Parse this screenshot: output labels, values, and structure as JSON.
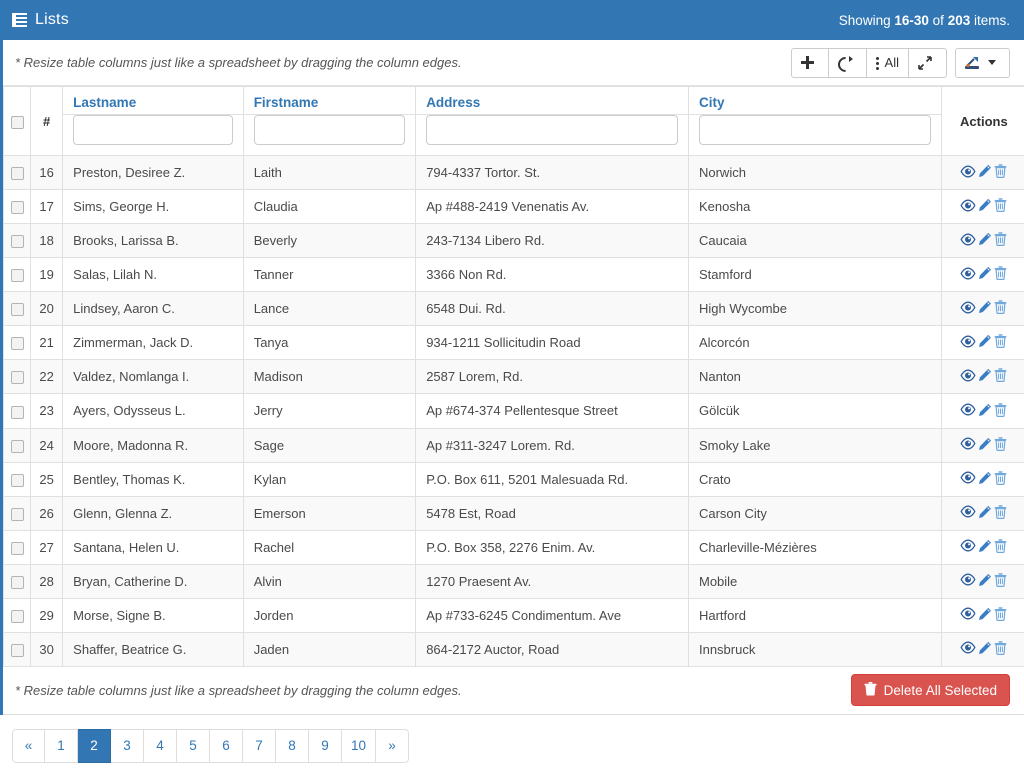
{
  "header": {
    "icon": "list-icon",
    "title": "Lists",
    "showing_prefix": "Showing",
    "showing_range": "16-30",
    "showing_of": "of",
    "showing_total": "203",
    "showing_suffix": "items.",
    "bg_color": "#3277b3"
  },
  "toolbar": {
    "hint": "* Resize table columns just like a spreadsheet by dragging the column edges.",
    "buttons": [
      {
        "name": "add-button",
        "icon": "plus-icon",
        "label": ""
      },
      {
        "name": "refresh-button",
        "icon": "refresh-icon",
        "label": ""
      },
      {
        "name": "columns-button",
        "icon": "vertical-dots-icon",
        "label": "All"
      },
      {
        "name": "fullscreen-button",
        "icon": "expand-arrows-icon",
        "label": ""
      }
    ],
    "export_button": {
      "name": "export-dropdown-button",
      "icon": "export-icon",
      "label": ""
    }
  },
  "table": {
    "select_all_checkbox": "",
    "num_header": "#",
    "actions_header": "Actions",
    "columns": [
      {
        "label": "Lastname",
        "filter_value": "",
        "filter_placeholder": ""
      },
      {
        "label": "Firstname",
        "filter_value": "",
        "filter_placeholder": ""
      },
      {
        "label": "Address",
        "filter_value": "",
        "filter_placeholder": ""
      },
      {
        "label": "City",
        "filter_value": "",
        "filter_placeholder": ""
      }
    ],
    "row_actions": [
      {
        "name": "view-action-icon",
        "icon": "eye-icon",
        "color": "#2f5f9e"
      },
      {
        "name": "edit-action-icon",
        "icon": "pencil-icon",
        "color": "#3b7dc4"
      },
      {
        "name": "delete-action-icon",
        "icon": "trash-icon",
        "color": "#6fa8dc"
      }
    ],
    "rows": [
      {
        "num": "16",
        "lastname": "Preston, Desiree Z.",
        "firstname": "Laith",
        "address": "794-4337 Tortor. St.",
        "city": "Norwich"
      },
      {
        "num": "17",
        "lastname": "Sims, George H.",
        "firstname": "Claudia",
        "address": "Ap #488-2419 Venenatis Av.",
        "city": "Kenosha"
      },
      {
        "num": "18",
        "lastname": "Brooks, Larissa B.",
        "firstname": "Beverly",
        "address": "243-7134 Libero Rd.",
        "city": "Caucaia"
      },
      {
        "num": "19",
        "lastname": "Salas, Lilah N.",
        "firstname": "Tanner",
        "address": "3366 Non Rd.",
        "city": "Stamford"
      },
      {
        "num": "20",
        "lastname": "Lindsey, Aaron C.",
        "firstname": "Lance",
        "address": "6548 Dui. Rd.",
        "city": "High Wycombe"
      },
      {
        "num": "21",
        "lastname": "Zimmerman, Jack D.",
        "firstname": "Tanya",
        "address": "934-1211 Sollicitudin Road",
        "city": "Alcorcón"
      },
      {
        "num": "22",
        "lastname": "Valdez, Nomlanga I.",
        "firstname": "Madison",
        "address": "2587 Lorem, Rd.",
        "city": "Nanton"
      },
      {
        "num": "23",
        "lastname": "Ayers, Odysseus L.",
        "firstname": "Jerry",
        "address": "Ap #674-374 Pellentesque Street",
        "city": "Gölcük"
      },
      {
        "num": "24",
        "lastname": "Moore, Madonna R.",
        "firstname": "Sage",
        "address": "Ap #311-3247 Lorem. Rd.",
        "city": "Smoky Lake"
      },
      {
        "num": "25",
        "lastname": "Bentley, Thomas K.",
        "firstname": "Kylan",
        "address": "P.O. Box 611, 5201 Malesuada Rd.",
        "city": "Crato"
      },
      {
        "num": "26",
        "lastname": "Glenn, Glenna Z.",
        "firstname": "Emerson",
        "address": "5478 Est, Road",
        "city": "Carson City"
      },
      {
        "num": "27",
        "lastname": "Santana, Helen U.",
        "firstname": "Rachel",
        "address": "P.O. Box 358, 2276 Enim. Av.",
        "city": "Charleville-Mézières"
      },
      {
        "num": "28",
        "lastname": "Bryan, Catherine D.",
        "firstname": "Alvin",
        "address": "1270 Praesent Av.",
        "city": "Mobile"
      },
      {
        "num": "29",
        "lastname": "Morse, Signe B.",
        "firstname": "Jorden",
        "address": "Ap #733-6245 Condimentum. Ave",
        "city": "Hartford"
      },
      {
        "num": "30",
        "lastname": "Shaffer, Beatrice G.",
        "firstname": "Jaden",
        "address": "864-2172 Auctor, Road",
        "city": "Innsbruck"
      }
    ]
  },
  "footer": {
    "hint": "* Resize table columns just like a spreadsheet by dragging the column edges.",
    "delete_label": "Delete All Selected",
    "delete_color": "#d9534f"
  },
  "pagination": {
    "prev": "«",
    "next": "»",
    "pages": [
      "1",
      "2",
      "3",
      "4",
      "5",
      "6",
      "7",
      "8",
      "9",
      "10"
    ],
    "active": "2",
    "active_color": "#3277b3"
  }
}
